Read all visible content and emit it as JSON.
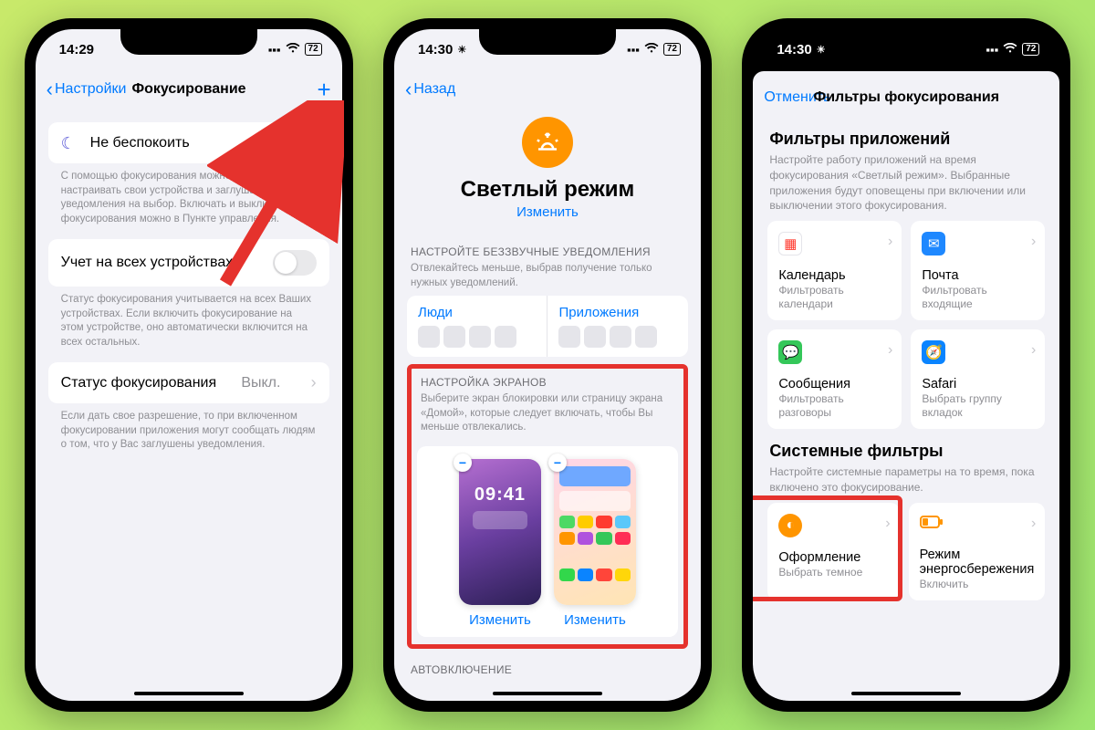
{
  "phone1": {
    "status": {
      "time": "14:29",
      "battery": "72"
    },
    "nav": {
      "back": "Настройки",
      "title": "Фокусирование",
      "plus": "+"
    },
    "dnd": "Не беспокоить",
    "dnd_footer": "С помощью фокусирования можно гибко настраивать свои устройства и заглушать вызовы и уведомления на выбор. Включать и выключать фокусирования можно в Пункте управления.",
    "share": "Учет на всех устройствах",
    "share_footer": "Статус фокусирования учитывается на всех Ваших устройствах. Если включить фокусирование на этом устройстве, оно автоматически включится на всех остальных.",
    "status_row": {
      "label": "Статус фокусирования",
      "value": "Выкл."
    },
    "status_footer": "Если дать свое разрешение, то при включенном фокусировании приложения могут сообщать людям о том, что у Вас заглушены уведомления."
  },
  "phone2": {
    "status": {
      "time": "14:30",
      "battery": "72"
    },
    "nav_back": "Назад",
    "focus": {
      "title": "Светлый режим",
      "change": "Изменить"
    },
    "silence": {
      "header": "НАСТРОЙТЕ БЕЗЗВУЧНЫЕ УВЕДОМЛЕНИЯ",
      "sub": "Отвлекайтесь меньше, выбрав получение только нужных уведомлений.",
      "people": "Люди",
      "apps": "Приложения"
    },
    "screens": {
      "header": "НАСТРОЙКА ЭКРАНОВ",
      "sub": "Выберите экран блокировки или страницу экрана «Домой», которые следует включать, чтобы Вы меньше отвлекались.",
      "lock_time": "09:41",
      "change": "Изменить"
    },
    "auto_header": "АВТОВКЛЮЧЕНИЕ"
  },
  "phone3": {
    "status": {
      "time": "14:30",
      "battery": "72"
    },
    "sheet": {
      "cancel": "Отменить",
      "title": "Фильтры фокусирования"
    },
    "app_filters": {
      "title": "Фильтры приложений",
      "desc": "Настройте работу приложений на время фокусирования «Светлый режим». Выбранные приложения будут оповещены при включении или выключении этого фокусирования.",
      "items": [
        {
          "name": "Календарь",
          "sub": "Фильтровать календари"
        },
        {
          "name": "Почта",
          "sub": "Фильтровать входящие"
        },
        {
          "name": "Сообщения",
          "sub": "Фильтровать разговоры"
        },
        {
          "name": "Safari",
          "sub": "Выбрать группу вкладок"
        }
      ]
    },
    "sys_filters": {
      "title": "Системные фильтры",
      "desc": "Настройте системные параметры на то время, пока включено это фокусирование.",
      "items": [
        {
          "name": "Оформление",
          "sub": "Выбрать темное"
        },
        {
          "name": "Режим энергосбережения",
          "sub": "Включить"
        }
      ]
    }
  }
}
